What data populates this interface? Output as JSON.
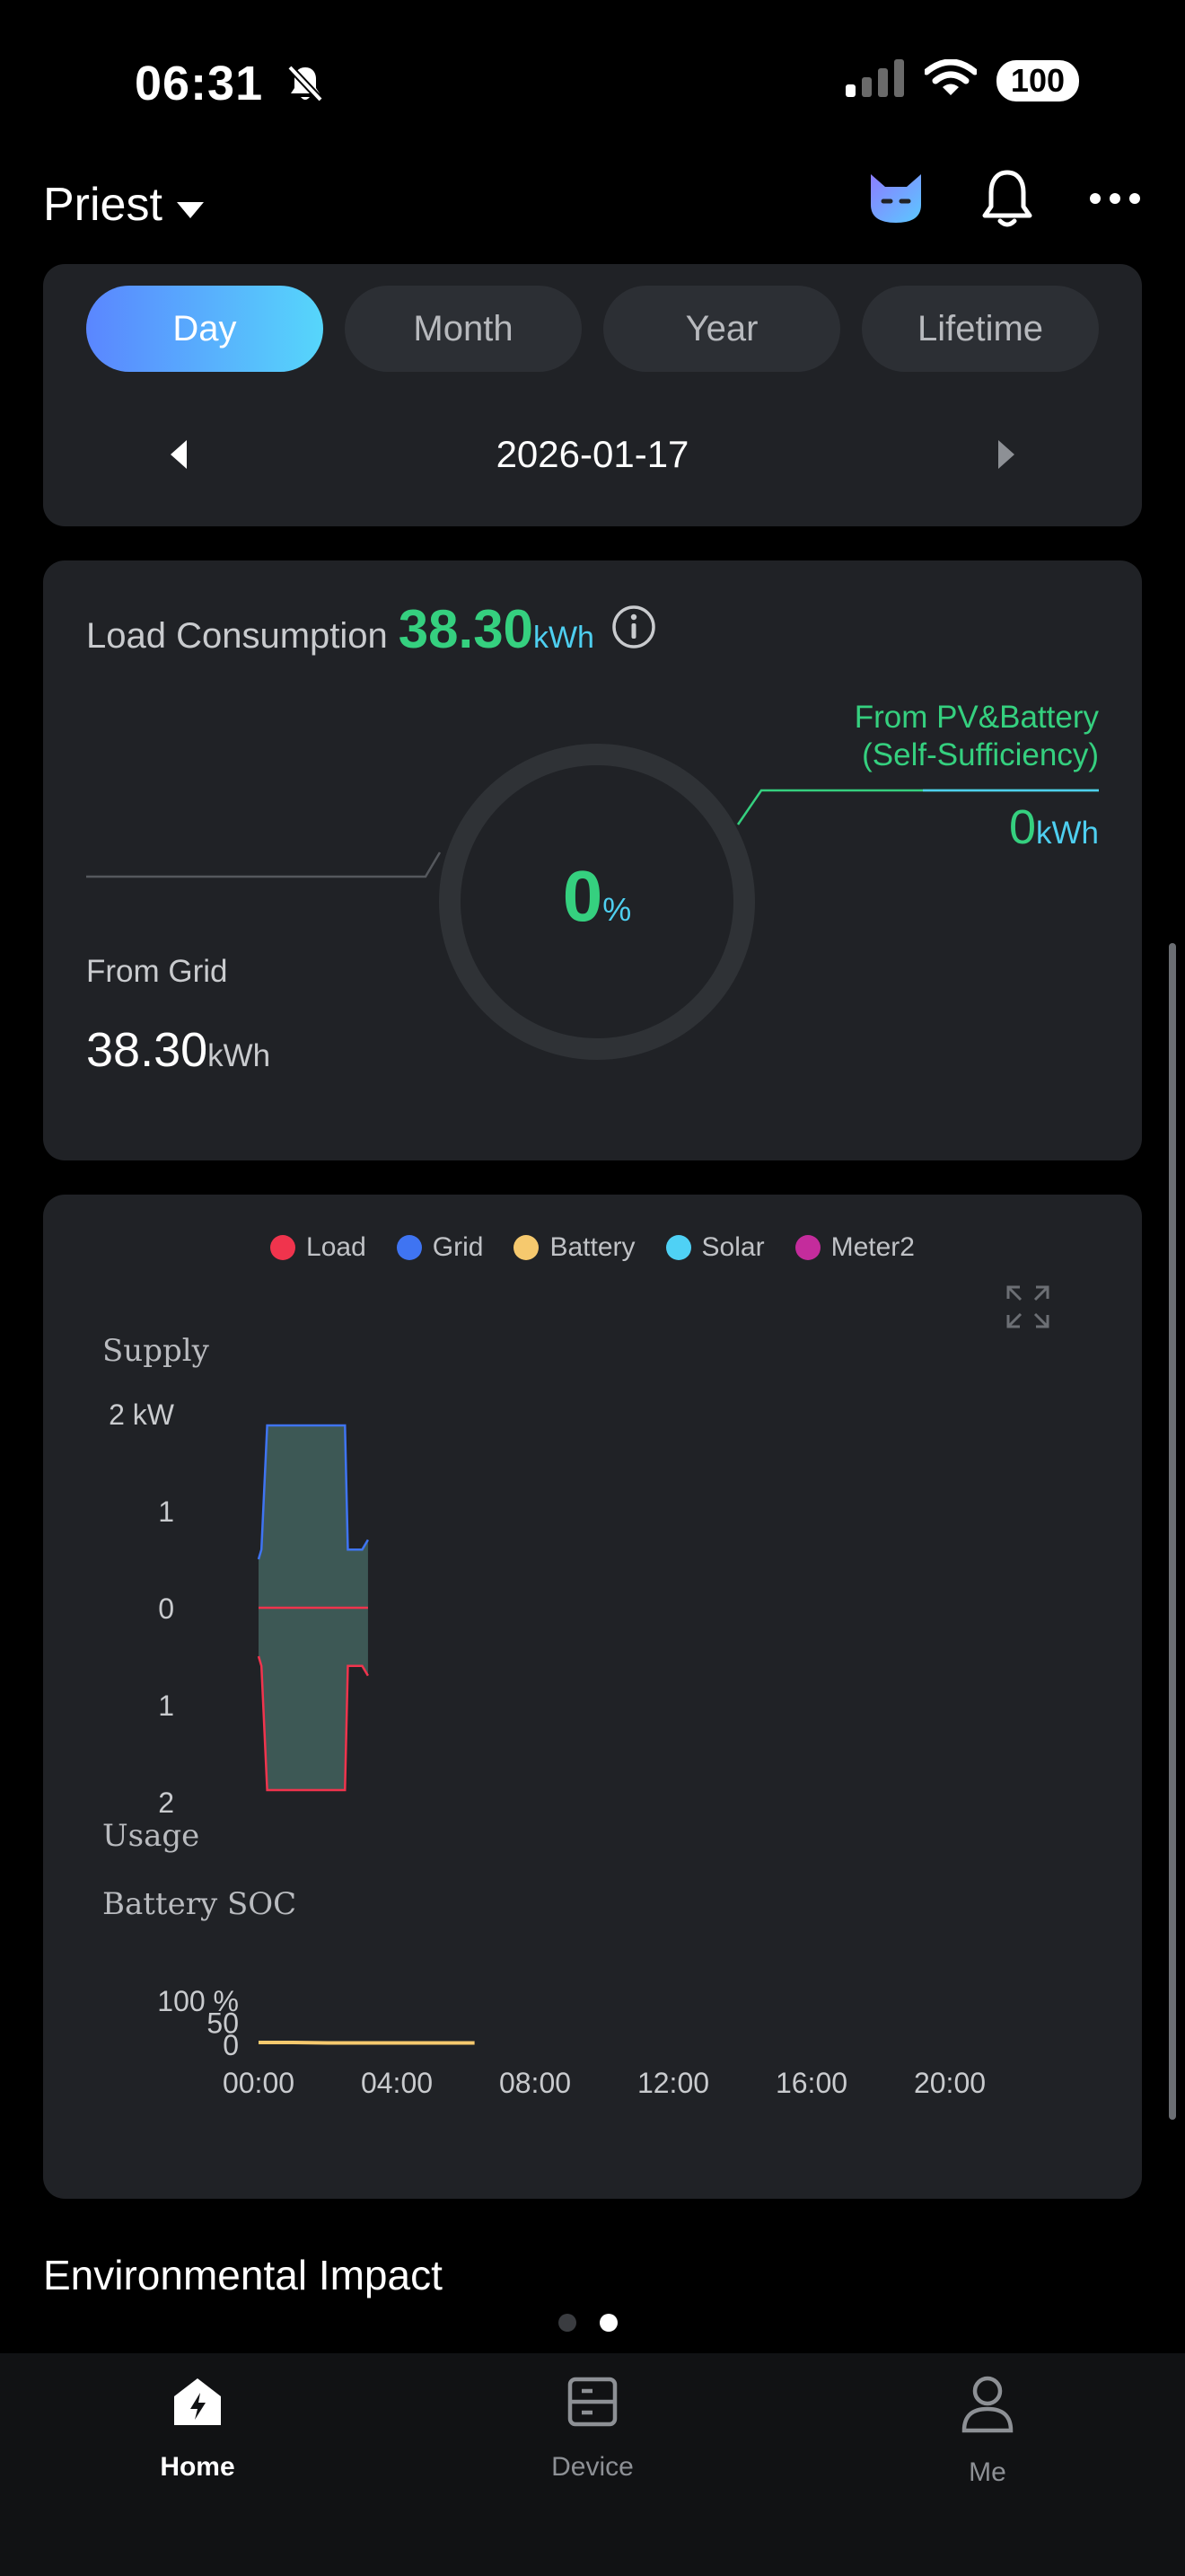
{
  "status": {
    "time": "06:31",
    "battery": "100"
  },
  "header": {
    "site_name": "Priest"
  },
  "period": {
    "tabs": [
      "Day",
      "Month",
      "Year",
      "Lifetime"
    ],
    "active_tab": "Day",
    "date": "2026-01-17"
  },
  "consumption": {
    "label": "Load Consumption",
    "value": "38.30",
    "unit": "kWh",
    "percent_value": "0",
    "percent_unit": "%",
    "pv_label_line1": "From PV&Battery",
    "pv_label_line2": "(Self-Sufficiency)",
    "pv_value": "0",
    "pv_unit": "kWh",
    "grid_label": "From Grid",
    "grid_value": "38.30",
    "grid_unit": "kWh"
  },
  "colors": {
    "load": "#f0344d",
    "grid": "#3f74f2",
    "battery": "#f6c96e",
    "solar": "#4fd1f5",
    "meter2": "#c42c9c",
    "accent_green": "#35d07f",
    "accent_cyan": "#4ecff0"
  },
  "chart_data": {
    "type": "area",
    "legend": [
      "Load",
      "Grid",
      "Battery",
      "Solar",
      "Meter2"
    ],
    "power": {
      "supply_label": "Supply",
      "usage_label": "Usage",
      "y_tick_labels": [
        "2 kW",
        "1",
        "0",
        "1",
        "2"
      ],
      "ylim": [
        -2,
        2
      ],
      "x": [
        "00:00",
        "00:05",
        "00:15",
        "00:20",
        "02:30",
        "02:35",
        "03:00",
        "03:10"
      ],
      "series": [
        {
          "name": "Grid",
          "values": [
            0.5,
            0.6,
            1.88,
            1.88,
            1.88,
            0.6,
            0.6,
            0.7
          ]
        },
        {
          "name": "Load",
          "values": [
            -0.5,
            -0.6,
            -1.88,
            -1.88,
            -1.88,
            -0.6,
            -0.6,
            -0.7
          ]
        }
      ]
    },
    "soc": {
      "label": "Battery SOC",
      "y_tick_labels": [
        "100 %",
        "50",
        "0"
      ],
      "ylim": [
        0,
        100
      ],
      "x_tick_labels": [
        "00:00",
        "04:00",
        "08:00",
        "12:00",
        "16:00",
        "20:00"
      ],
      "series": [
        {
          "name": "Battery",
          "x": [
            "00:00",
            "01:00",
            "02:00",
            "03:00",
            "04:00",
            "05:00",
            "06:00",
            "06:15"
          ],
          "values": [
            4,
            4,
            3,
            3,
            3,
            3,
            3,
            3
          ]
        }
      ]
    }
  },
  "environment": {
    "title": "Environmental Impact"
  },
  "nav": {
    "items": [
      "Home",
      "Device",
      "Me"
    ],
    "active": "Home"
  }
}
